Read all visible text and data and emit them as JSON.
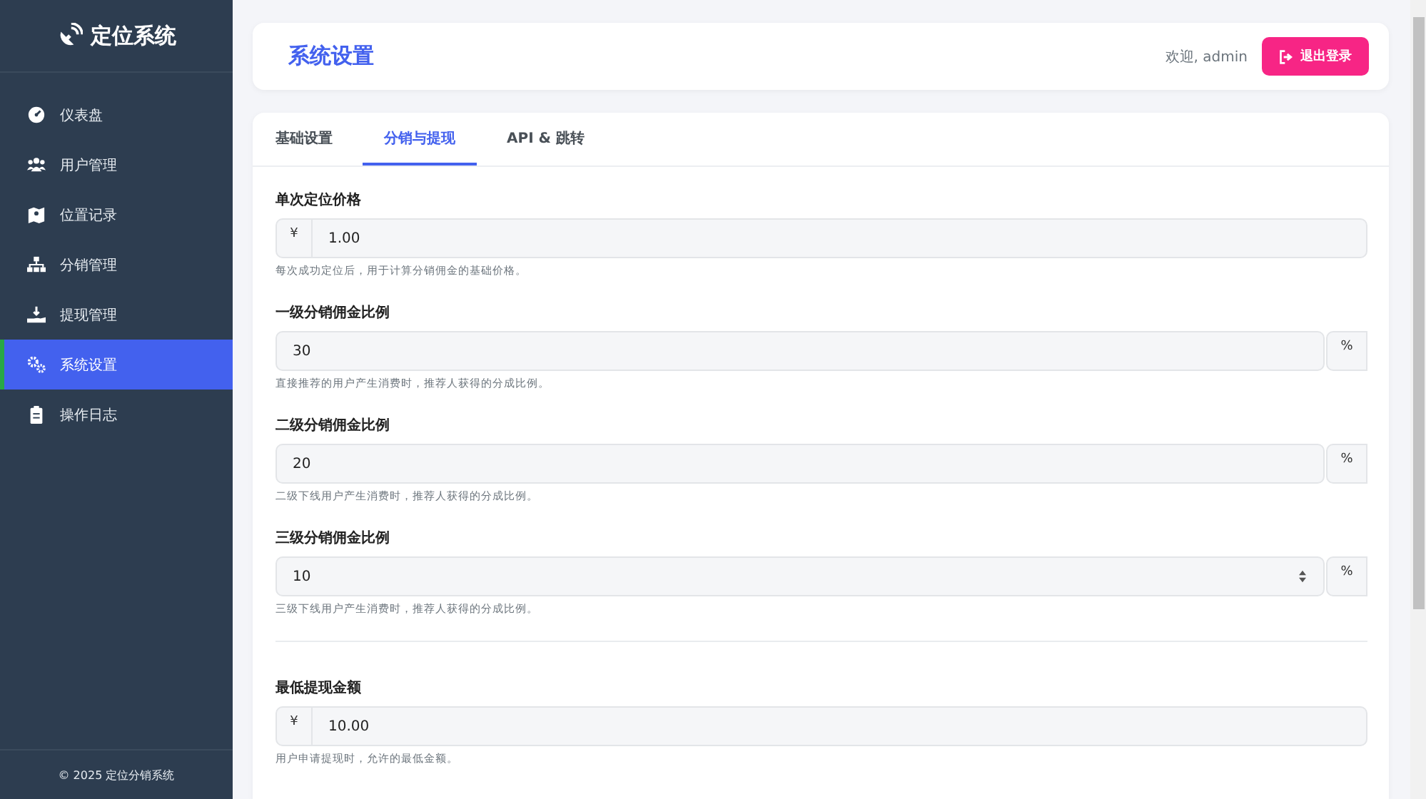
{
  "sidebar": {
    "brand": "定位系统",
    "items": [
      {
        "label": "仪表盘",
        "selected": false
      },
      {
        "label": "用户管理",
        "selected": false
      },
      {
        "label": "位置记录",
        "selected": false
      },
      {
        "label": "分销管理",
        "selected": false
      },
      {
        "label": "提现管理",
        "selected": false
      },
      {
        "label": "系统设置",
        "selected": true
      },
      {
        "label": "操作日志",
        "selected": false
      }
    ],
    "footer": "© 2025 定位分销系统"
  },
  "header": {
    "title": "系统设置",
    "welcome": "欢迎, admin",
    "logout": "退出登录"
  },
  "tabs": [
    {
      "label": "基础设置",
      "selected": false
    },
    {
      "label": "分销与提现",
      "selected": true
    },
    {
      "label": "API & 跳转",
      "selected": false
    }
  ],
  "groups": [
    {
      "fields": [
        {
          "label": "单次定位价格",
          "prefix": "¥",
          "value": "1.00",
          "hint": "每次成功定位后，用于计算分销佣金的基础价格。",
          "spinner": false
        },
        {
          "label": "一级分销佣金比例",
          "value": "30",
          "suffix": "%",
          "hint": "直接推荐的用户产生消费时，推荐人获得的分成比例。",
          "spinner": false
        },
        {
          "label": "二级分销佣金比例",
          "value": "20",
          "suffix": "%",
          "hint": "二级下线用户产生消费时，推荐人获得的分成比例。",
          "spinner": false
        },
        {
          "label": "三级分销佣金比例",
          "value": "10",
          "suffix": "%",
          "hint": "三级下线用户产生消费时，推荐人获得的分成比例。",
          "spinner": true
        }
      ]
    },
    {
      "fields": [
        {
          "label": "最低提现金额",
          "prefix": "¥",
          "value": "10.00",
          "hint": "用户申请提现时，允许的最低金额。",
          "spinner": false
        }
      ]
    }
  ]
}
